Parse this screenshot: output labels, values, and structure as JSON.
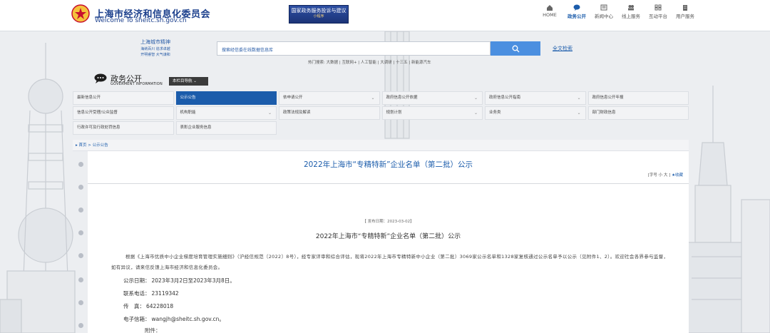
{
  "header": {
    "site_title": "上海市经济和信息化委员会",
    "site_subtitle": "Welcome To sheitc.sh.gov.cn",
    "banner_line1": "国家政务服务投诉与建议",
    "banner_line2": "小程序",
    "nav": [
      {
        "label": "HOME",
        "icon": "home-icon"
      },
      {
        "label": "政务公开",
        "icon": "chat-icon"
      },
      {
        "label": "新闻中心",
        "icon": "news-icon"
      },
      {
        "label": "线上服务",
        "icon": "users-icon"
      },
      {
        "label": "互动平台",
        "icon": "grid-icon"
      },
      {
        "label": "用户服务",
        "icon": "building-icon"
      }
    ]
  },
  "slogan": {
    "title": "上海城市精神",
    "line1": "海纳百川 追求卓越",
    "line2": "开明睿智 大气谦和"
  },
  "search": {
    "placeholder": "搜索经信委在线数据信息库",
    "fulltext_label": "全文检索",
    "hot_words": "热门搜索: 大数据 | 互联网+ | 人工智能 | 大调研 | 十三五 | 新能源汽车"
  },
  "gov_info": {
    "title": "政务公开",
    "subtitle": "GOVERMENT INFORMATION",
    "column_nav_label": "本栏目导航 ⌄"
  },
  "categories": [
    {
      "label": "最新信息公开",
      "dropdown": false,
      "active": false
    },
    {
      "label": "公示公告",
      "dropdown": false,
      "active": true
    },
    {
      "label": "依申请公开",
      "dropdown": true,
      "active": false
    },
    {
      "label": "政府信息公开依据",
      "dropdown": true,
      "active": false
    },
    {
      "label": "政府信息公开指南",
      "dropdown": true,
      "active": false
    },
    {
      "label": "政府信息公开年报",
      "dropdown": false,
      "active": false
    },
    {
      "label": "信息公开受理/公众监督",
      "dropdown": false,
      "active": false
    },
    {
      "label": "机构职能",
      "dropdown": true,
      "active": false
    },
    {
      "label": "政策法规及解读",
      "dropdown": false,
      "active": false
    },
    {
      "label": "规划计划",
      "dropdown": true,
      "active": false
    },
    {
      "label": "业务类",
      "dropdown": true,
      "active": false
    },
    {
      "label": "部门财政信息",
      "dropdown": false,
      "active": false
    },
    {
      "label": "行政许可及行政处罚信息",
      "dropdown": false,
      "active": false
    },
    {
      "label": "表彰企业服务信息",
      "dropdown": false,
      "active": false
    }
  ],
  "breadcrumb": "▸ 首页 > 公示公告",
  "article": {
    "title": "2022年上海市“专精特新”企业名单（第二批）公示",
    "tools": "[字号  小    大  ]",
    "fav_label": "★收藏",
    "pub_date": "【 发布日期：2023-03-02】",
    "subtitle": "2022年上海市“专精特新”企业名单（第二批）公示",
    "paragraph": "根据《上海市优质中小企业梯度培育管理实施细则》（沪经信规范〔2022〕8号），经专家评审和综合评估，现将2022年上海市专精特新中小企业（第二批）3069家公示名单和1328家复核通过公示名单予以公示（见附件1、2）。欢迎社会各界参与监督，如有异议，请来信反馈上海市经济和信息化委员会。",
    "period_label": "公示日期：",
    "period_value": "2023年3月2日至2023年3月8日。",
    "phone_label": "联系电话：",
    "phone_value": "23119342",
    "fax_label": "传　真：",
    "fax_value": "64228018",
    "email_label": "电子信箱：",
    "email_value": "wangjh@sheitc.sh.gov.cn。",
    "attach_label": "附件："
  },
  "colors": {
    "brand_blue": "#1b5cab",
    "search_button": "#4b8fe0",
    "active_tab": "#1b5cab"
  }
}
